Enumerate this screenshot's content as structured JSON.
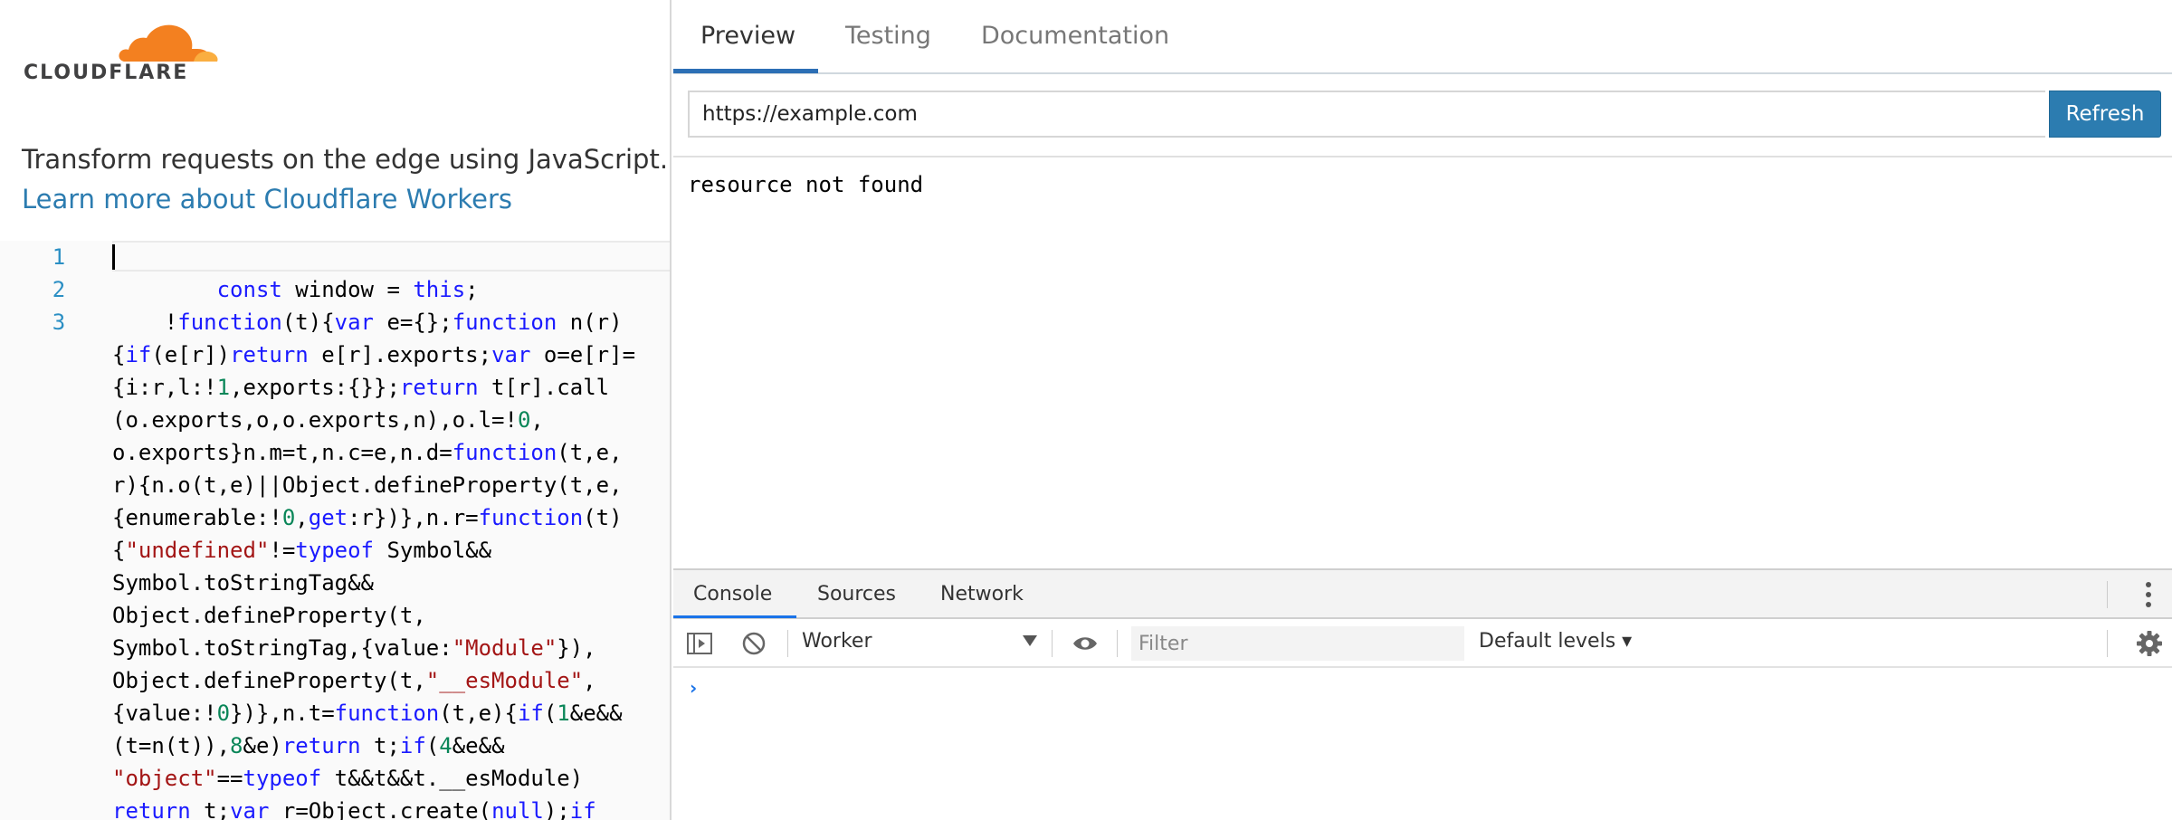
{
  "brand": {
    "logo_text": "CLOUDFLARE",
    "orange": "#f38020",
    "light_orange": "#faae40"
  },
  "intro": {
    "text": "Transform requests on the edge using JavaScript.",
    "link": "Learn more about Cloudflare Workers"
  },
  "editor": {
    "line_numbers": [
      "1",
      "2",
      "3"
    ],
    "lines": [
      [],
      [
        [
          "",
          "        "
        ],
        [
          "kw",
          "const"
        ],
        [
          "",
          " window = "
        ],
        [
          "kw",
          "this"
        ],
        [
          "",
          ";"
        ]
      ],
      [
        [
          "",
          "    !"
        ],
        [
          "kw",
          "function"
        ],
        [
          "",
          "(t){"
        ],
        [
          "kw",
          "var"
        ],
        [
          "",
          " e={};"
        ],
        [
          "kw",
          "function"
        ],
        [
          "",
          " n(r)"
        ]
      ],
      [
        [
          "",
          "{"
        ],
        [
          "kw",
          "if"
        ],
        [
          "",
          "(e[r])"
        ],
        [
          "kw",
          "return"
        ],
        [
          "",
          " e[r].exports;"
        ],
        [
          "kw",
          "var"
        ],
        [
          "",
          " o=e[r]="
        ]
      ],
      [
        [
          "",
          "{i:r,l:!"
        ],
        [
          "num",
          "1"
        ],
        [
          "",
          ",exports:{}};"
        ],
        [
          "kw",
          "return"
        ],
        [
          "",
          " t[r].call"
        ]
      ],
      [
        [
          "",
          "(o.exports,o,o.exports,n),o.l=!"
        ],
        [
          "num",
          "0"
        ],
        [
          "",
          ","
        ]
      ],
      [
        [
          "",
          "o.exports}n.m=t,n.c=e,n.d="
        ],
        [
          "kw",
          "function"
        ],
        [
          "",
          "(t,e,"
        ]
      ],
      [
        [
          "",
          "r){n.o(t,e)||Object.defineProperty(t,e,"
        ]
      ],
      [
        [
          "",
          "{enumerable:!"
        ],
        [
          "num",
          "0"
        ],
        [
          "",
          ","
        ],
        [
          "kw",
          "get"
        ],
        [
          "",
          ":r})},n.r="
        ],
        [
          "kw",
          "function"
        ],
        [
          "",
          "(t)"
        ]
      ],
      [
        [
          "",
          "{"
        ],
        [
          "str",
          "\"undefined\""
        ],
        [
          "",
          "!="
        ],
        [
          "kw",
          "typeof"
        ],
        [
          "",
          " Symbol&&"
        ]
      ],
      [
        [
          "",
          "Symbol.toStringTag&&"
        ]
      ],
      [
        [
          "",
          "Object.defineProperty(t,"
        ]
      ],
      [
        [
          "",
          "Symbol.toStringTag,{value:"
        ],
        [
          "str",
          "\"Module\""
        ],
        [
          "",
          "}),"
        ]
      ],
      [
        [
          "",
          "Object.defineProperty(t,"
        ],
        [
          "str",
          "\"__esModule\""
        ],
        [
          "",
          ","
        ]
      ],
      [
        [
          "",
          "{value:!"
        ],
        [
          "num",
          "0"
        ],
        [
          "",
          "})},n.t="
        ],
        [
          "kw",
          "function"
        ],
        [
          "",
          "(t,e){"
        ],
        [
          "kw",
          "if"
        ],
        [
          "",
          "("
        ],
        [
          "num",
          "1"
        ],
        [
          "",
          "&e&&"
        ]
      ],
      [
        [
          "",
          "(t=n(t)),"
        ],
        [
          "num",
          "8"
        ],
        [
          "",
          "&e)"
        ],
        [
          "kw",
          "return"
        ],
        [
          "",
          " t;"
        ],
        [
          "kw",
          "if"
        ],
        [
          "",
          "("
        ],
        [
          "num",
          "4"
        ],
        [
          "",
          "&e&&"
        ]
      ],
      [
        [
          "str",
          "\"object\""
        ],
        [
          "",
          "=="
        ],
        [
          "kw",
          "typeof"
        ],
        [
          "",
          " t&&t&&t.__esModule)"
        ]
      ],
      [
        [
          "kw",
          "return"
        ],
        [
          "",
          " t;"
        ],
        [
          "kw",
          "var"
        ],
        [
          "",
          " r=Object.create("
        ],
        [
          "kw",
          "null"
        ],
        [
          "",
          ");"
        ],
        [
          "kw",
          "if"
        ]
      ]
    ]
  },
  "tabs": [
    "Preview",
    "Testing",
    "Documentation"
  ],
  "active_tab": "Preview",
  "url": {
    "value": "https://example.com",
    "button": "Refresh"
  },
  "preview_output": "resource not found",
  "devtools": {
    "tabs": [
      "Console",
      "Sources",
      "Network"
    ],
    "active_tab": "Console",
    "context": "Worker",
    "filter_placeholder": "Filter",
    "levels": "Default levels ▾",
    "prompt": "›"
  }
}
